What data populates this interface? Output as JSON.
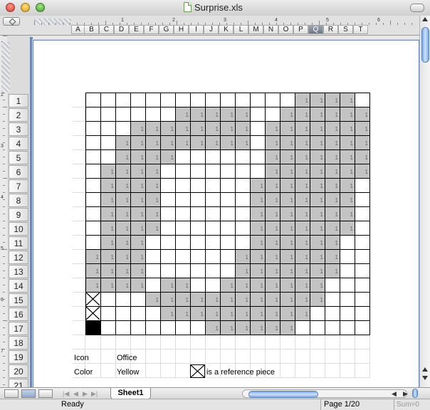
{
  "window": {
    "title": "Surprise.xls"
  },
  "ruler_numbers": [
    "1",
    "2",
    "3",
    "4",
    "5",
    "6"
  ],
  "vruler_numbers": [
    "1",
    "2",
    "3",
    "4",
    "5",
    "6",
    "7"
  ],
  "columns": [
    "A",
    "B",
    "C",
    "D",
    "E",
    "F",
    "G",
    "H",
    "I",
    "J",
    "K",
    "L",
    "M",
    "N",
    "O",
    "P",
    "Q",
    "R",
    "S",
    "T"
  ],
  "selected_column": "Q",
  "rows": [
    "1",
    "2",
    "3",
    "4",
    "5",
    "6",
    "7",
    "8",
    "9",
    "10",
    "11",
    "12",
    "13",
    "14",
    "15",
    "16",
    "17",
    "18",
    "19",
    "20",
    "21"
  ],
  "grid": {
    "fill_value": "1",
    "filled": [
      [
        15,
        16,
        17,
        18
      ],
      [
        7,
        8,
        9,
        10,
        11,
        14,
        15,
        16,
        17,
        18,
        19
      ],
      [
        4,
        5,
        6,
        7,
        8,
        9,
        10,
        11,
        13,
        14,
        15,
        16,
        17,
        18,
        19
      ],
      [
        3,
        4,
        5,
        6,
        7,
        8,
        9,
        10,
        11,
        13,
        14,
        15,
        16,
        17,
        18,
        19
      ],
      [
        3,
        4,
        5,
        6,
        13,
        14,
        15,
        16,
        17,
        18,
        19
      ],
      [
        2,
        3,
        4,
        5,
        13,
        14,
        15,
        16,
        17,
        18,
        19
      ],
      [
        2,
        3,
        4,
        5,
        12,
        13,
        14,
        15,
        16,
        17,
        18
      ],
      [
        2,
        3,
        4,
        5,
        12,
        13,
        14,
        15,
        16,
        17,
        18
      ],
      [
        2,
        3,
        4,
        5,
        12,
        13,
        14,
        15,
        16,
        17,
        18
      ],
      [
        2,
        3,
        4,
        5,
        12,
        13,
        14,
        15,
        16,
        17,
        18
      ],
      [
        2,
        3,
        4,
        12,
        13,
        14,
        15,
        16,
        17
      ],
      [
        1,
        2,
        3,
        4,
        11,
        12,
        13,
        14,
        15,
        16,
        17
      ],
      [
        1,
        2,
        3,
        4,
        11,
        12,
        13,
        14,
        15,
        16,
        17
      ],
      [
        1,
        2,
        3,
        4,
        6,
        7,
        10,
        11,
        12,
        13,
        14,
        15,
        16
      ],
      [
        5,
        6,
        7,
        8,
        9,
        10,
        11,
        12,
        13,
        14,
        15,
        16
      ],
      [
        6,
        7,
        8,
        9,
        10,
        11,
        12,
        13,
        14,
        15
      ],
      [
        9,
        10,
        11,
        12,
        13,
        14
      ]
    ],
    "cross_rows": [
      15,
      16
    ],
    "black_rows": [
      17
    ]
  },
  "legend": {
    "icon_label": "Icon",
    "icon_value": "Office",
    "color_label": "Color",
    "color_value": "Yellow",
    "ref_text": "is a reference piece"
  },
  "bottom": {
    "sheet_tab": "Sheet1"
  },
  "status": {
    "text": "Ready",
    "page": "Page 1/20",
    "sum": "Sum=0"
  }
}
